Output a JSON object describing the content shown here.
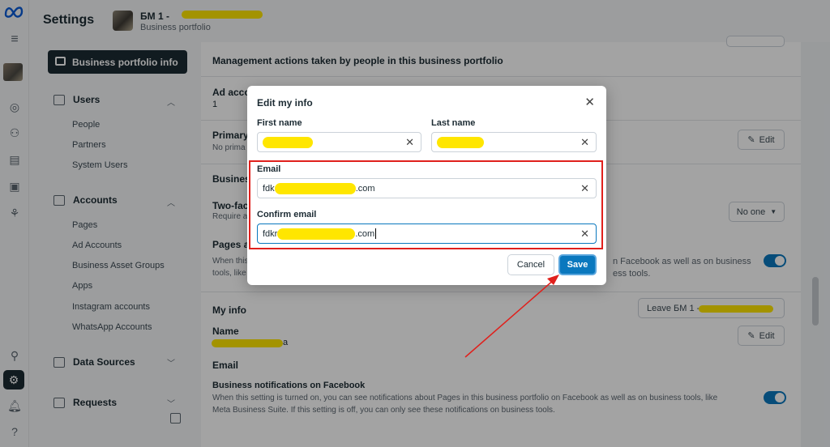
{
  "header": {
    "title": "Settings",
    "portfolio_name": "БМ 1 -",
    "portfolio_sub": "Business portfolio"
  },
  "sidebar": {
    "active_item": "Business portfolio info",
    "users_section": "Users",
    "users_items": [
      "People",
      "Partners",
      "System Users"
    ],
    "accounts_section": "Accounts",
    "accounts_items": [
      "Pages",
      "Ad Accounts",
      "Business Asset Groups",
      "Apps",
      "Instagram accounts",
      "WhatsApp Accounts"
    ],
    "data_sources_section": "Data Sources",
    "requests_section": "Requests"
  },
  "main": {
    "management_text": "Management actions taken by people in this business portfolio",
    "ad_acc_label": "Ad acco",
    "ad_acc_value": "1",
    "primary_label": "Primary",
    "primary_sub": "No prima",
    "edit_label": "Edit",
    "business_label": "Busines",
    "twofa_label": "Two-fac",
    "twofa_sub": "Require a",
    "no_one_label": "No one",
    "pages_label": "Pages ar",
    "pages_sub_1": "When this",
    "pages_sub_2": "tools, like",
    "pages_right_1": "n Facebook as well as on business",
    "pages_right_2": "ess tools.",
    "my_info": "My info",
    "leave_label": "Leave БМ 1 -",
    "name_label": "Name",
    "name_value_suffix": "a",
    "email_label": "Email",
    "notif_label": "Business notifications on Facebook",
    "notif_sub_1": "When this setting is turned on, you can see notifications about Pages in this business portfolio on Facebook as well as on business tools, like",
    "notif_sub_2": "Meta Business Suite. If this setting is off, you can only see these notifications on business tools."
  },
  "modal": {
    "title": "Edit my info",
    "first_name_label": "First name",
    "last_name_label": "Last name",
    "email_label": "Email",
    "email_prefix": "fdk",
    "email_suffix": ".com",
    "confirm_label": "Confirm email",
    "confirm_prefix": "fdkr",
    "confirm_suffix": ".com",
    "cancel_label": "Cancel",
    "save_label": "Save"
  },
  "colors": {
    "accent": "#0a78be",
    "annotation_red": "#e0201c",
    "redaction": "#ffe600"
  }
}
